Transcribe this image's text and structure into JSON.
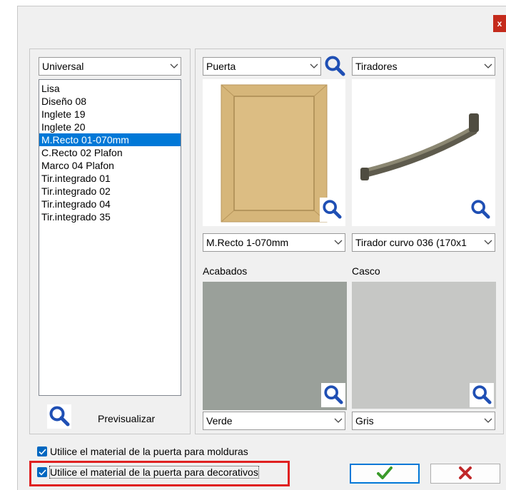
{
  "window": {
    "close_glyph": "x"
  },
  "left": {
    "category_select": "Universal",
    "models": [
      "Lisa",
      "Diseño 08",
      "Inglete 19",
      "Inglete 20",
      "M.Recto 01-070mm",
      "C.Recto 02 Plafon",
      "Marco 04 Plafon",
      "Tir.integrado 01",
      "Tir.integrado 02",
      "Tir.integrado 04",
      "Tir.integrado 35"
    ],
    "selected_index": 4,
    "preview_label": "Previsualizar",
    "preview_icon": "magnifier-icon"
  },
  "right": {
    "door_select": "Puerta",
    "door_model_select": "M.Recto 1-070mm",
    "handle_category_select": "Tiradores",
    "handle_select": "Tirador curvo 036 (170x1",
    "finishes_label": "Acabados",
    "finish_select": "Verde",
    "carcass_label": "Casco",
    "carcass_select": "Gris"
  },
  "colors": {
    "finish_swatch": "#9aa09a",
    "carcass_swatch": "#c6c7c5",
    "door_wood": "#d6b67a",
    "handle_metal": "#6f6c5c",
    "accent": "#0078d7",
    "ok_green": "#3a9a2a",
    "cancel_red": "#c0282a",
    "highlight": "#e02020"
  },
  "options": {
    "use_door_material_moldings": "Utilice el material de la puerta para molduras",
    "use_door_material_moldings_checked": true,
    "use_door_material_decoratives": "Utilice el material de la puerta para decorativos",
    "use_door_material_decoratives_checked": true
  },
  "actions": {
    "ok_icon": "checkmark-icon",
    "cancel_icon": "cross-icon"
  }
}
